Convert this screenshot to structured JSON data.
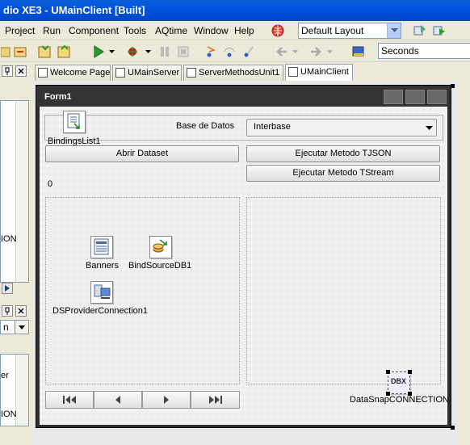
{
  "window": {
    "title": "dio XE3 - UMainClient [Built]"
  },
  "menu": {
    "items": [
      "Project",
      "Run",
      "Component",
      "Tools",
      "AQtime",
      "Window",
      "Help"
    ]
  },
  "toolbar": {
    "layout_select": "Default Layout",
    "search_field": "Seconds"
  },
  "tabs": [
    {
      "label": "Welcome Page"
    },
    {
      "label": "UMainServer"
    },
    {
      "label": "ServerMethodsUnit1"
    },
    {
      "label": "UMainClient"
    }
  ],
  "left_panel": {
    "fragment1": "ION",
    "fragment2": "n",
    "fragment3": "er",
    "fragment4": "ION"
  },
  "form": {
    "title": "Form1",
    "bindings_list": "BindingsList1",
    "db_label": "Base de Datos",
    "db_value": "Interbase",
    "open_dataset": "Abrir Dataset",
    "exec_tjson": "Ejecutar Metodo TJSON",
    "exec_tstream": "Ejecutar Metodo TStream",
    "counter": "0",
    "banners": "Banners",
    "bind_source": "BindSourceDB1",
    "ds_provider": "DSProviderConnection1",
    "datasnap": "DataSnapCONNECTION",
    "datasnap_badge": "DBX"
  },
  "colors": {
    "titlebar": "#0054e3",
    "form_caption": "#333333"
  }
}
